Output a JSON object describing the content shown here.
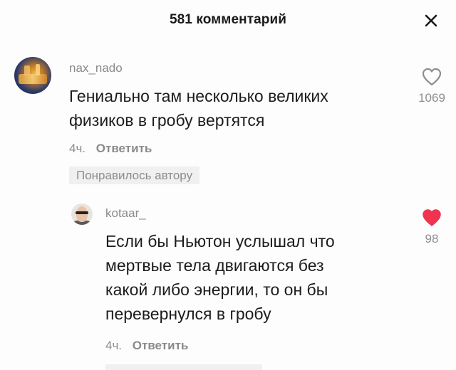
{
  "header": {
    "title": "581 комментарий"
  },
  "comments": [
    {
      "username": "nax_nado",
      "text_lines": [
        "Гениально там несколько великих",
        "физиков в гробу вертятся"
      ],
      "time": "4ч.",
      "reply_label": "Ответить",
      "badge": "Понравилось автору",
      "likes": "1069",
      "liked": false
    }
  ],
  "replies": [
    {
      "username": "kotaar_",
      "text_lines": [
        "Если бы Ньютон услышал что",
        "мертвые тела двигаются без",
        "какой либо энергии, то он бы",
        "перевернулся в гробу"
      ],
      "time": "4ч.",
      "reply_label": "Ответить",
      "likes": "98",
      "liked": true
    }
  ],
  "colors": {
    "like_active": "#f0334e",
    "like_inactive": "#8e8e8e",
    "text_primary": "#1c1c1c",
    "text_secondary": "#8e8e8e",
    "badge_bg": "#f0f0f0"
  },
  "icons": {
    "close": "close-icon",
    "like": "heart-icon"
  }
}
